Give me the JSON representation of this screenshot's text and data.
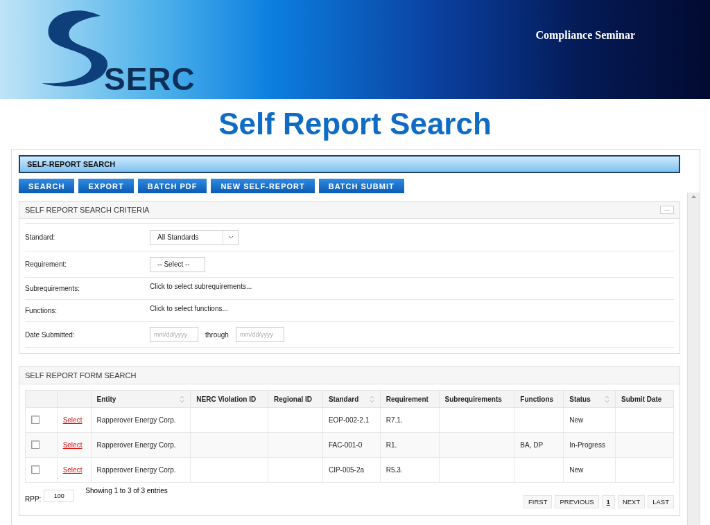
{
  "banner": {
    "logo_text": "SERC",
    "subtitle": "Compliance Seminar"
  },
  "slide_title": "Self Report Search",
  "page_bar": {
    "title": "SELF-REPORT SEARCH"
  },
  "toolbar": [
    "SEARCH",
    "EXPORT",
    "BATCH PDF",
    "NEW SELF-REPORT",
    "BATCH SUBMIT"
  ],
  "criteria": {
    "title": "SELF REPORT SEARCH CRITERIA",
    "collapse": "—",
    "fields": [
      {
        "kind": "select",
        "label": "Standard:",
        "value": "All Standards"
      },
      {
        "kind": "select_small",
        "label": "Requirement:",
        "value": "-- Select --"
      },
      {
        "kind": "link",
        "label": "Subrequirements:",
        "value": "Click to select subrequirements..."
      },
      {
        "kind": "link",
        "label": "Functions:",
        "value": "Click to select functions..."
      },
      {
        "kind": "daterange",
        "label": "Date Submitted:",
        "from_placeholder": "mm/dd/yyyy",
        "through": "through",
        "to_placeholder": "mm/dd/yyyy"
      }
    ]
  },
  "results": {
    "title": "SELF REPORT FORM SEARCH",
    "columns": [
      {
        "sortable": false
      },
      {
        "sortable": false
      },
      {
        "label": "Entity",
        "sortable": true
      },
      {
        "label": "NERC Violation ID",
        "sortable": false
      },
      {
        "label": "Regional ID",
        "sortable": false
      },
      {
        "label": "Standard",
        "sortable": true
      },
      {
        "label": "Requirement",
        "sortable": false
      },
      {
        "label": "Subrequirements",
        "sortable": false
      },
      {
        "label": "Functions",
        "sortable": false
      },
      {
        "label": "Status",
        "sortable": true
      },
      {
        "label": "Submit Date",
        "sortable": false
      }
    ],
    "rows": [
      {
        "checked": false,
        "action": "Select",
        "entity": "Rapperover Energy Corp.",
        "standard": "EOP-002-2.1",
        "requirement": "R7.1.",
        "status": "New"
      },
      {
        "checked": false,
        "action": "Select",
        "entity": "Rapperover Energy Corp.",
        "standard": "FAC-001-0",
        "requirement": "R1.",
        "functions": "BA, DP",
        "status": "In-Progress"
      },
      {
        "checked": false,
        "action": "Select",
        "entity": "Rapperover Energy Corp.",
        "standard": "CIP-005-2a",
        "requirement": "R5.3.",
        "status": "New"
      }
    ],
    "rpp_label": "RPP:",
    "rpp_value": "100",
    "summary": "Showing 1 to 3 of 3 entries",
    "pagination": [
      {
        "label": "FIRST",
        "selected": false
      },
      {
        "label": "PREVIOUS",
        "selected": false
      },
      {
        "label": "1",
        "selected": true
      },
      {
        "label": "NEXT",
        "selected": false
      },
      {
        "label": "LAST",
        "selected": false
      }
    ]
  }
}
